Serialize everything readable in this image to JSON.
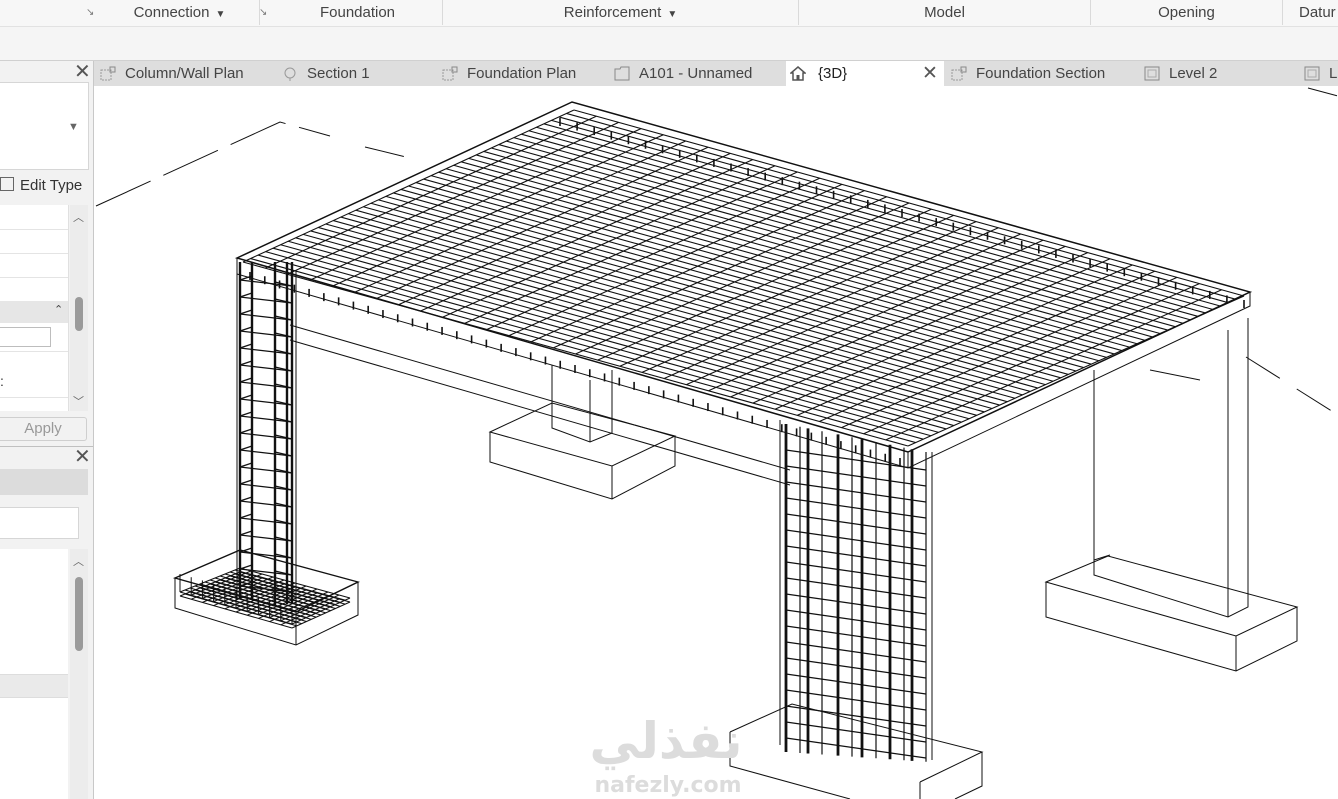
{
  "ribbon": {
    "panels": [
      {
        "label": "Connection",
        "dropdown": true
      },
      {
        "label": "Foundation",
        "dropdown": false
      },
      {
        "label": "Reinforcement",
        "dropdown": true
      },
      {
        "label": "Model",
        "dropdown": false
      },
      {
        "label": "Opening",
        "dropdown": false
      },
      {
        "label": "Datur",
        "dropdown": false
      }
    ]
  },
  "tabs": [
    {
      "label": "Column/Wall Plan",
      "icon": "plan-view-icon"
    },
    {
      "label": "Section 1",
      "icon": "section-view-icon"
    },
    {
      "label": "Foundation Plan",
      "icon": "plan-view-icon"
    },
    {
      "label": "A101 - Unnamed",
      "icon": "sheet-icon"
    },
    {
      "label": "{3D}",
      "icon": "home-3d-icon",
      "active": true
    },
    {
      "label": "Foundation Section",
      "icon": "plan-view-icon"
    },
    {
      "label": "Level 2",
      "icon": "sheet-icon"
    },
    {
      "label": "L",
      "icon": "sheet-icon"
    }
  ],
  "properties": {
    "edit_type_label": "Edit Type",
    "apply_label": "Apply",
    "row_fragment": ":"
  },
  "watermark": {
    "arabic": "نفذلي",
    "latin": "nafezly.com"
  },
  "colors": {
    "ribbon_bg": "#f7f7f7",
    "tabbar_bg": "#dedede",
    "active_tab_bg": "#ffffff",
    "model_lines": "#111111"
  }
}
